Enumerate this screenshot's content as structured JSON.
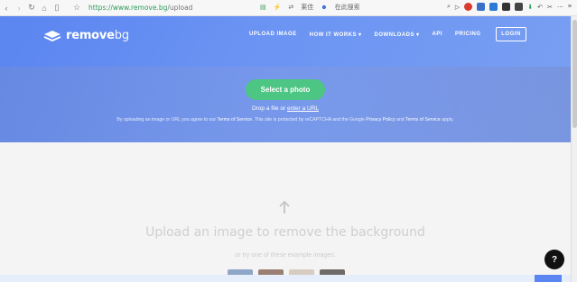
{
  "browser": {
    "url_host": "https://www.remove.bg",
    "url_path": "/upload",
    "translate_label": "莱佳",
    "search_label": "在此搜索"
  },
  "nav": {
    "logo_word_main": "remove",
    "logo_word_bg": "bg",
    "menu": [
      {
        "label": "UPLOAD IMAGE"
      },
      {
        "label": "HOW IT WORKS"
      },
      {
        "label": "DOWNLOADS"
      },
      {
        "label": "API"
      },
      {
        "label": "PRICING"
      }
    ],
    "login_label": "LOGIN"
  },
  "hero": {
    "select_button": "Select a photo",
    "drop_text": "Drop a file or",
    "enter_url": "enter a URL",
    "terms_prefix": "By uploading an image or URL you agree to our",
    "terms_link": "Terms of Service",
    "terms_middle": ". This site is protected by reCAPTCHA and the Google",
    "privacy_link": "Privacy Policy",
    "and": "and",
    "terms_link2": "Terms of Service",
    "terms_suffix": "apply."
  },
  "lower": {
    "headline": "Upload an image to remove the background",
    "sub": "or try one of these example images:"
  },
  "help_label": "?",
  "colors": {
    "brand": "#5b85f0",
    "button": "#4dc583"
  }
}
